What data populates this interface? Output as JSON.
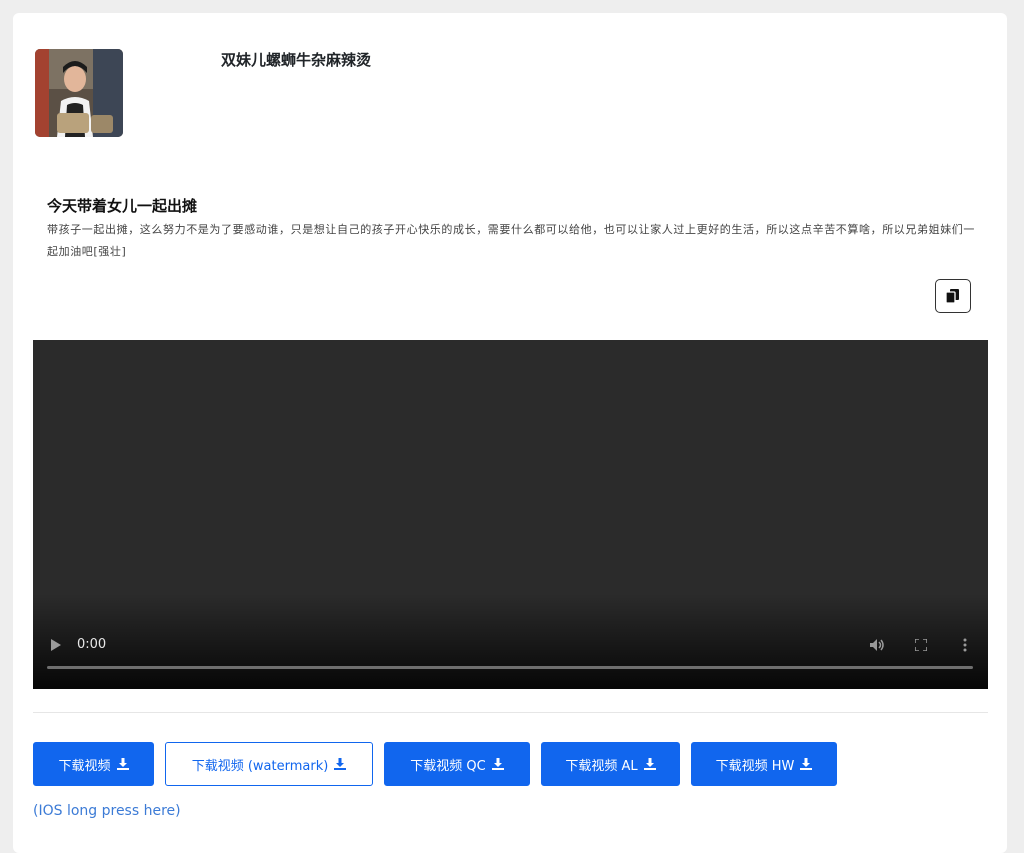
{
  "author": {
    "name": "双妹儿螺蛳牛杂麻辣烫"
  },
  "post": {
    "title": "今天带着女儿一起出摊",
    "description": "带孩子一起出摊，这么努力不是为了要感动谁，只是想让自己的孩子开心快乐的成长，需要什么都可以给他，也可以让家人过上更好的生活，所以这点辛苦不算啥，所以兄弟姐妹们一起加油吧[强壮]"
  },
  "video": {
    "time": "0:00",
    "progress": 0
  },
  "downloads": [
    {
      "label": "下载视频",
      "style": "primary"
    },
    {
      "label": "下载视频 (watermark)",
      "style": "outline"
    },
    {
      "label": "下载视频 QC",
      "style": "primary"
    },
    {
      "label": "下载视频 AL",
      "style": "primary"
    },
    {
      "label": "下载视频 HW",
      "style": "primary"
    }
  ],
  "ios_hint": "(IOS long press here)",
  "icons": {
    "copy": "copy-icon",
    "play": "play-icon",
    "volume": "volume-icon",
    "fullscreen": "fullscreen-icon",
    "more": "more-vertical-icon",
    "download": "download-icon"
  },
  "colors": {
    "accent": "#1166ee",
    "link": "#3c7bd6",
    "video_bg": "#2b2b2b"
  }
}
